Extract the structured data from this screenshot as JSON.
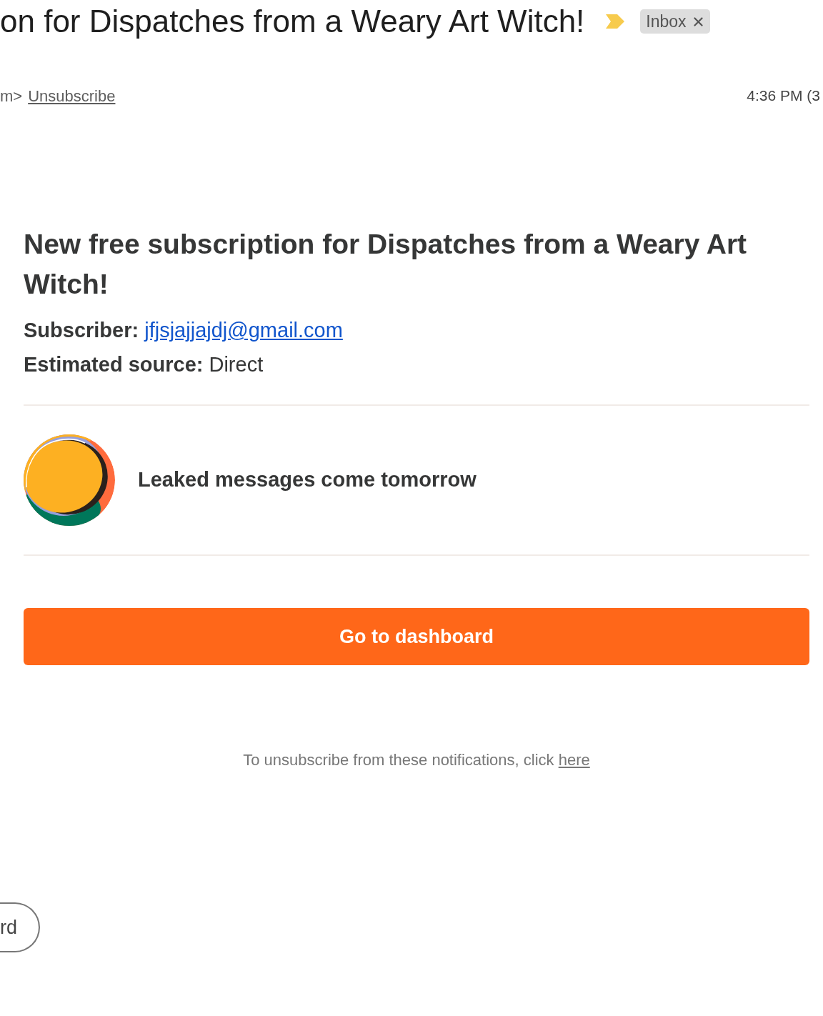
{
  "header": {
    "subject": "on for Dispatches from a Weary Art Witch!",
    "important": true,
    "labels": [
      {
        "text": "Inbox"
      }
    ],
    "sender_tail": "m>",
    "unsubscribe": "Unsubscribe",
    "time": "4:36 PM (3"
  },
  "message": {
    "title": "New free subscription for Dispatches from a Weary Art Witch!",
    "details": [
      {
        "kind": "link",
        "label": "Subscriber:",
        "value": "jfjsjajjajdj@gmail.com"
      },
      {
        "kind": "text",
        "label": "Estimated source:",
        "value": "Direct"
      }
    ],
    "publication": {
      "name": "Leaked messages come tomorrow"
    },
    "button": "Go to dashboard",
    "footer": {
      "text": "To unsubscribe from these notifications, click",
      "link": "here"
    }
  },
  "actions": [
    {
      "label": "rd"
    }
  ]
}
